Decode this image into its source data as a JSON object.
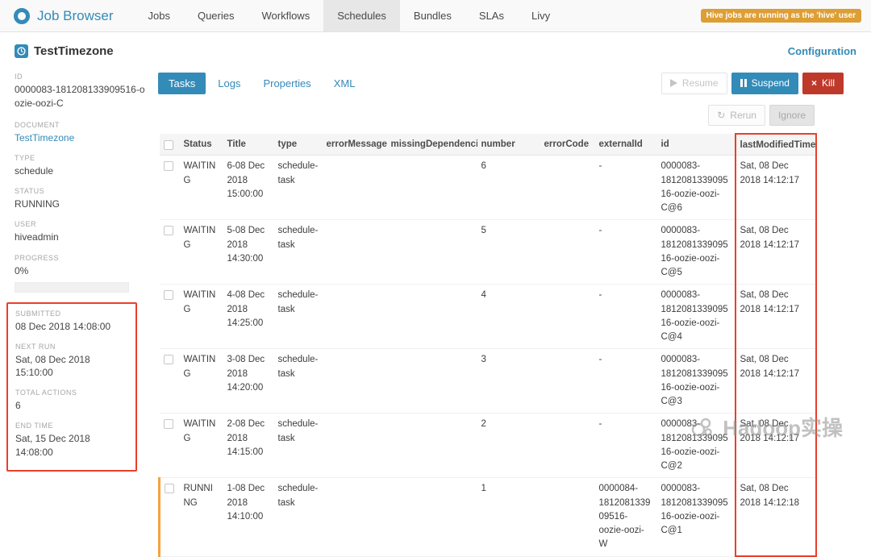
{
  "topbar": {
    "app_title": "Job Browser",
    "nav": [
      "Jobs",
      "Queries",
      "Workflows",
      "Schedules",
      "Bundles",
      "SLAs",
      "Livy"
    ],
    "active_tab": "Schedules",
    "warning_badge": "Hive jobs are running as the 'hive' user"
  },
  "header": {
    "title": "TestTimezone",
    "configuration_link": "Configuration"
  },
  "sidebar": {
    "id": {
      "label": "ID",
      "value": "0000083-181208133909516-oozie-oozi-C"
    },
    "document": {
      "label": "DOCUMENT",
      "value": "TestTimezone"
    },
    "type": {
      "label": "TYPE",
      "value": "schedule"
    },
    "status": {
      "label": "STATUS",
      "value": "RUNNING"
    },
    "user": {
      "label": "USER",
      "value": "hiveadmin"
    },
    "progress": {
      "label": "PROGRESS",
      "value": "0%",
      "percent": 0
    },
    "submitted": {
      "label": "SUBMITTED",
      "value": "08 Dec 2018 14:08:00"
    },
    "next_run": {
      "label": "NEXT RUN",
      "value": "Sat, 08 Dec 2018 15:10:00"
    },
    "total_actions": {
      "label": "TOTAL ACTIONS",
      "value": "6"
    },
    "end_time": {
      "label": "END TIME",
      "value": "Sat, 15 Dec 2018 14:08:00"
    }
  },
  "main": {
    "tabs": [
      "Tasks",
      "Logs",
      "Properties",
      "XML"
    ],
    "active_tab": "Tasks",
    "actions": {
      "resume": "Resume",
      "suspend": "Suspend",
      "kill": "Kill",
      "rerun": "Rerun",
      "ignore": "Ignore"
    },
    "table": {
      "columns": [
        "Status",
        "Title",
        "type",
        "errorMessage",
        "missingDependencies",
        "number",
        "errorCode",
        "externalId",
        "id",
        "lastModifiedTime"
      ],
      "rows": [
        {
          "status": "WAITING",
          "title": "6-08 Dec 2018 15:00:00",
          "type": "schedule-task",
          "errorMessage": "",
          "missingDependencies": "",
          "number": "6",
          "errorCode": "",
          "externalId": "-",
          "id": "0000083-181208133909516-oozie-oozi-C@6",
          "lastModifiedTime": "Sat, 08 Dec 2018 14:12:17"
        },
        {
          "status": "WAITING",
          "title": "5-08 Dec 2018 14:30:00",
          "type": "schedule-task",
          "errorMessage": "",
          "missingDependencies": "",
          "number": "5",
          "errorCode": "",
          "externalId": "-",
          "id": "0000083-181208133909516-oozie-oozi-C@5",
          "lastModifiedTime": "Sat, 08 Dec 2018 14:12:17"
        },
        {
          "status": "WAITING",
          "title": "4-08 Dec 2018 14:25:00",
          "type": "schedule-task",
          "errorMessage": "",
          "missingDependencies": "",
          "number": "4",
          "errorCode": "",
          "externalId": "-",
          "id": "0000083-181208133909516-oozie-oozi-C@4",
          "lastModifiedTime": "Sat, 08 Dec 2018 14:12:17"
        },
        {
          "status": "WAITING",
          "title": "3-08 Dec 2018 14:20:00",
          "type": "schedule-task",
          "errorMessage": "",
          "missingDependencies": "",
          "number": "3",
          "errorCode": "",
          "externalId": "-",
          "id": "0000083-181208133909516-oozie-oozi-C@3",
          "lastModifiedTime": "Sat, 08 Dec 2018 14:12:17"
        },
        {
          "status": "WAITING",
          "title": "2-08 Dec 2018 14:15:00",
          "type": "schedule-task",
          "errorMessage": "",
          "missingDependencies": "",
          "number": "2",
          "errorCode": "",
          "externalId": "-",
          "id": "0000083-181208133909516-oozie-oozi-C@2",
          "lastModifiedTime": "Sat, 08 Dec 2018 14:12:17"
        },
        {
          "status": "RUNNING",
          "title": "1-08 Dec 2018 14:10:00",
          "type": "schedule-task",
          "errorMessage": "",
          "missingDependencies": "",
          "number": "1",
          "errorCode": "",
          "externalId": "0000084-181208133909516-oozie-oozi-W",
          "id": "0000083-181208133909516-oozie-oozi-C@1",
          "lastModifiedTime": "Sat, 08 Dec 2018 14:12:18"
        }
      ]
    }
  },
  "icons": {
    "kill_glyph": "×",
    "rerun_glyph": "↻"
  },
  "watermark": {
    "text": "Hadoop实操"
  },
  "colors": {
    "accent": "#338bb8",
    "kill_red": "#bf392b",
    "warning_orange": "#dd9e35",
    "annotation_red": "#e8402a",
    "running_bar_orange": "#f5a33e"
  }
}
